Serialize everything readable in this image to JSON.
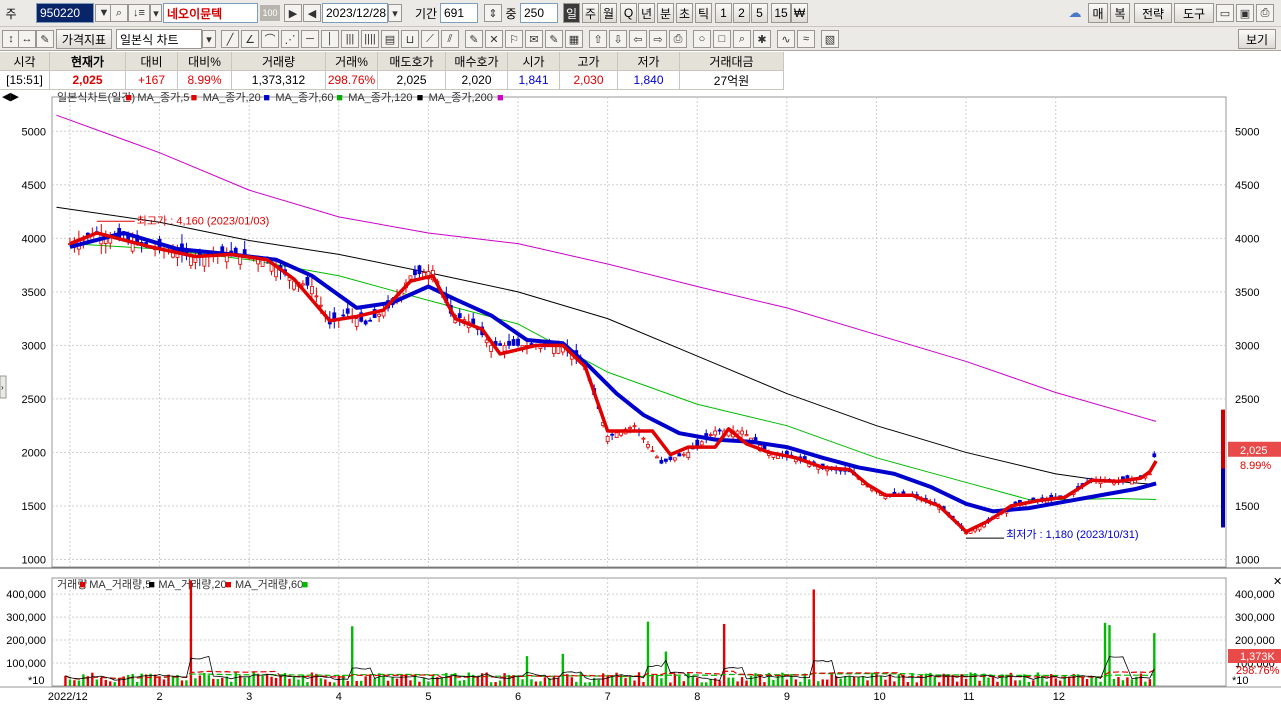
{
  "toolbar": {
    "market_label": "주",
    "code": "950220",
    "stock_name": "네오이뮨텍",
    "stock_badge": "100",
    "date": "2023/12/28",
    "period_label": "기간",
    "period": "691",
    "zoom_label": "중",
    "zoom": "250",
    "intervals": [
      "일",
      "주",
      "월",
      "Q",
      "년",
      "분",
      "초",
      "틱",
      "1",
      "2",
      "5",
      "15",
      "₩"
    ],
    "right_buttons": {
      "sell": "매",
      "buy": "복",
      "strategy": "전략",
      "tools": "도구"
    },
    "indicator_btn": "가격지표",
    "chart_type": "일본식 차트",
    "view_btn": "보기"
  },
  "quote": {
    "headers": [
      "시각",
      "현재가",
      "대비",
      "대비%",
      "거래량",
      "거래%",
      "매도호가",
      "매수호가",
      "시가",
      "고가",
      "저가",
      "거래대금"
    ],
    "values": [
      "[15:51]",
      "2,025",
      "+167",
      "8.99%",
      "1,373,312",
      "298.76%",
      "2,025",
      "2,020",
      "1,841",
      "2,030",
      "1,840",
      "27억원"
    ]
  },
  "chart_data": {
    "type": "candlestick",
    "legend": [
      "일본식차트(일간)",
      "MA_종가,5",
      "MA_종가,20",
      "MA_종가,60",
      "MA_종가,120",
      "MA_종가,200"
    ],
    "legend_colors": [
      "#444444",
      "#e00000",
      "#e00000",
      "#0000cc",
      "#00aa00",
      "#000000",
      "#cc00cc"
    ],
    "y_ticks": [
      1000,
      1500,
      2000,
      2500,
      3000,
      3500,
      4000,
      4500,
      5000
    ],
    "ylim": [
      930,
      5320
    ],
    "x_labels": [
      "2022/12",
      "2",
      "3",
      "4",
      "5",
      "6",
      "7",
      "8",
      "9",
      "10",
      "11",
      "12"
    ],
    "x_months": [
      0,
      1,
      2,
      3,
      4,
      5,
      6,
      7,
      8,
      9,
      10,
      11
    ],
    "x_range": [
      -0.2,
      12.9
    ],
    "price_path": [
      [
        0,
        3950
      ],
      [
        0.3,
        4050
      ],
      [
        0.9,
        3920
      ],
      [
        1.4,
        3830
      ],
      [
        1.8,
        3850
      ],
      [
        2.2,
        3800
      ],
      [
        2.5,
        3600
      ],
      [
        2.7,
        3550
      ],
      [
        2.9,
        3200
      ],
      [
        3.1,
        3300
      ],
      [
        3.3,
        3200
      ],
      [
        3.6,
        3380
      ],
      [
        3.8,
        3650
      ],
      [
        4.05,
        3700
      ],
      [
        4.25,
        3300
      ],
      [
        4.5,
        3200
      ],
      [
        4.7,
        3000
      ],
      [
        5.0,
        3000
      ],
      [
        5.3,
        3000
      ],
      [
        5.5,
        3000
      ],
      [
        5.75,
        2800
      ],
      [
        6.0,
        2150
      ],
      [
        6.15,
        2200
      ],
      [
        6.3,
        2250
      ],
      [
        6.6,
        1900
      ],
      [
        6.9,
        2000
      ],
      [
        7.2,
        2200
      ],
      [
        7.5,
        2200
      ],
      [
        7.8,
        2000
      ],
      [
        8.1,
        1950
      ],
      [
        8.4,
        1850
      ],
      [
        8.7,
        1820
      ],
      [
        8.9,
        1700
      ],
      [
        9.1,
        1600
      ],
      [
        9.4,
        1600
      ],
      [
        9.7,
        1500
      ],
      [
        10.0,
        1250
      ],
      [
        10.25,
        1350
      ],
      [
        10.5,
        1500
      ],
      [
        10.8,
        1550
      ],
      [
        11.1,
        1580
      ],
      [
        11.4,
        1750
      ],
      [
        11.7,
        1730
      ],
      [
        11.95,
        1760
      ],
      [
        12.05,
        1800
      ],
      [
        12.12,
        2025
      ]
    ],
    "ma5_path": [
      [
        0,
        3950
      ],
      [
        0.3,
        4050
      ],
      [
        0.9,
        3920
      ],
      [
        1.4,
        3830
      ],
      [
        1.8,
        3850
      ],
      [
        2.2,
        3800
      ],
      [
        2.5,
        3620
      ],
      [
        2.9,
        3230
      ],
      [
        3.2,
        3270
      ],
      [
        3.5,
        3330
      ],
      [
        3.8,
        3600
      ],
      [
        4.05,
        3650
      ],
      [
        4.3,
        3250
      ],
      [
        4.6,
        3150
      ],
      [
        4.8,
        2920
      ],
      [
        5.2,
        3000
      ],
      [
        5.5,
        3000
      ],
      [
        5.75,
        2800
      ],
      [
        6.0,
        2200
      ],
      [
        6.2,
        2200
      ],
      [
        6.5,
        2200
      ],
      [
        6.7,
        1980
      ],
      [
        6.9,
        2050
      ],
      [
        7.2,
        2050
      ],
      [
        7.35,
        2220
      ],
      [
        7.55,
        2080
      ],
      [
        7.8,
        2000
      ],
      [
        8.1,
        1950
      ],
      [
        8.4,
        1860
      ],
      [
        8.7,
        1840
      ],
      [
        8.9,
        1700
      ],
      [
        9.1,
        1600
      ],
      [
        9.4,
        1600
      ],
      [
        9.7,
        1500
      ],
      [
        10.0,
        1260
      ],
      [
        10.25,
        1360
      ],
      [
        10.5,
        1500
      ],
      [
        10.8,
        1550
      ],
      [
        11.1,
        1580
      ],
      [
        11.4,
        1740
      ],
      [
        11.7,
        1730
      ],
      [
        11.95,
        1760
      ],
      [
        12.05,
        1820
      ],
      [
        12.12,
        1920
      ]
    ],
    "ma20_path": [
      [
        0,
        3920
      ],
      [
        0.6,
        4050
      ],
      [
        1.2,
        3900
      ],
      [
        1.8,
        3850
      ],
      [
        2.3,
        3800
      ],
      [
        2.7,
        3650
      ],
      [
        3.2,
        3350
      ],
      [
        3.6,
        3400
      ],
      [
        4.0,
        3550
      ],
      [
        4.3,
        3430
      ],
      [
        4.7,
        3280
      ],
      [
        5.1,
        3050
      ],
      [
        5.5,
        3020
      ],
      [
        5.8,
        2800
      ],
      [
        6.1,
        2550
      ],
      [
        6.4,
        2350
      ],
      [
        6.8,
        2180
      ],
      [
        7.2,
        2120
      ],
      [
        7.6,
        2100
      ],
      [
        8.0,
        2050
      ],
      [
        8.4,
        1950
      ],
      [
        8.8,
        1860
      ],
      [
        9.2,
        1800
      ],
      [
        9.6,
        1680
      ],
      [
        10.0,
        1520
      ],
      [
        10.3,
        1450
      ],
      [
        10.7,
        1480
      ],
      [
        11.1,
        1540
      ],
      [
        11.5,
        1600
      ],
      [
        11.9,
        1660
      ],
      [
        12.12,
        1710
      ]
    ],
    "ma60_path": [
      [
        0,
        3950
      ],
      [
        1.0,
        3900
      ],
      [
        2.0,
        3800
      ],
      [
        3.0,
        3650
      ],
      [
        4.0,
        3420
      ],
      [
        5.0,
        3200
      ],
      [
        6.0,
        2750
      ],
      [
        7.0,
        2450
      ],
      [
        8.0,
        2250
      ],
      [
        9.0,
        1950
      ],
      [
        10.0,
        1720
      ],
      [
        10.7,
        1560
      ],
      [
        11.2,
        1560
      ],
      [
        11.7,
        1570
      ],
      [
        12.12,
        1560
      ]
    ],
    "ma120_path": [
      [
        -0.15,
        4290
      ],
      [
        1.0,
        4150
      ],
      [
        2.0,
        3980
      ],
      [
        3.0,
        3850
      ],
      [
        4.0,
        3680
      ],
      [
        5.0,
        3500
      ],
      [
        6.0,
        3250
      ],
      [
        7.0,
        2900
      ],
      [
        8.0,
        2550
      ],
      [
        9.0,
        2250
      ],
      [
        10.0,
        2000
      ],
      [
        11.0,
        1800
      ],
      [
        11.5,
        1740
      ],
      [
        12.12,
        1700
      ]
    ],
    "ma200_path": [
      [
        -0.15,
        5150
      ],
      [
        1.0,
        4800
      ],
      [
        2.0,
        4450
      ],
      [
        3.0,
        4200
      ],
      [
        4.0,
        4050
      ],
      [
        5.0,
        3950
      ],
      [
        6.0,
        3760
      ],
      [
        7.0,
        3550
      ],
      [
        8.0,
        3350
      ],
      [
        9.0,
        3100
      ],
      [
        10.0,
        2850
      ],
      [
        11.0,
        2560
      ],
      [
        12.12,
        2290
      ]
    ],
    "high_annot": "최고가 : 4,160 (2023/01/03)",
    "low_annot": "최저가 : 1,180 (2023/10/31)",
    "price_tag": "2,025",
    "pct_tag": "8.99%",
    "volume": {
      "legend": [
        "거래량",
        "MA_거래량,5",
        "MA_거래량,20",
        "MA_거래량,60"
      ],
      "y_ticks": [
        100000,
        200000,
        300000,
        400000
      ],
      "ylim": [
        0,
        470000
      ],
      "tag_volume": "1,373K",
      "tag_pct": "298.76%",
      "unit": "*10",
      "spikes": [
        [
          1.35,
          460000
        ],
        [
          3.15,
          260000
        ],
        [
          5.1,
          130000
        ],
        [
          5.5,
          140000
        ],
        [
          6.45,
          280000
        ],
        [
          6.65,
          150000
        ],
        [
          7.3,
          270000
        ],
        [
          8.3,
          420000
        ],
        [
          11.55,
          275000
        ],
        [
          11.6,
          265000
        ],
        [
          12.1,
          230000
        ]
      ]
    }
  }
}
